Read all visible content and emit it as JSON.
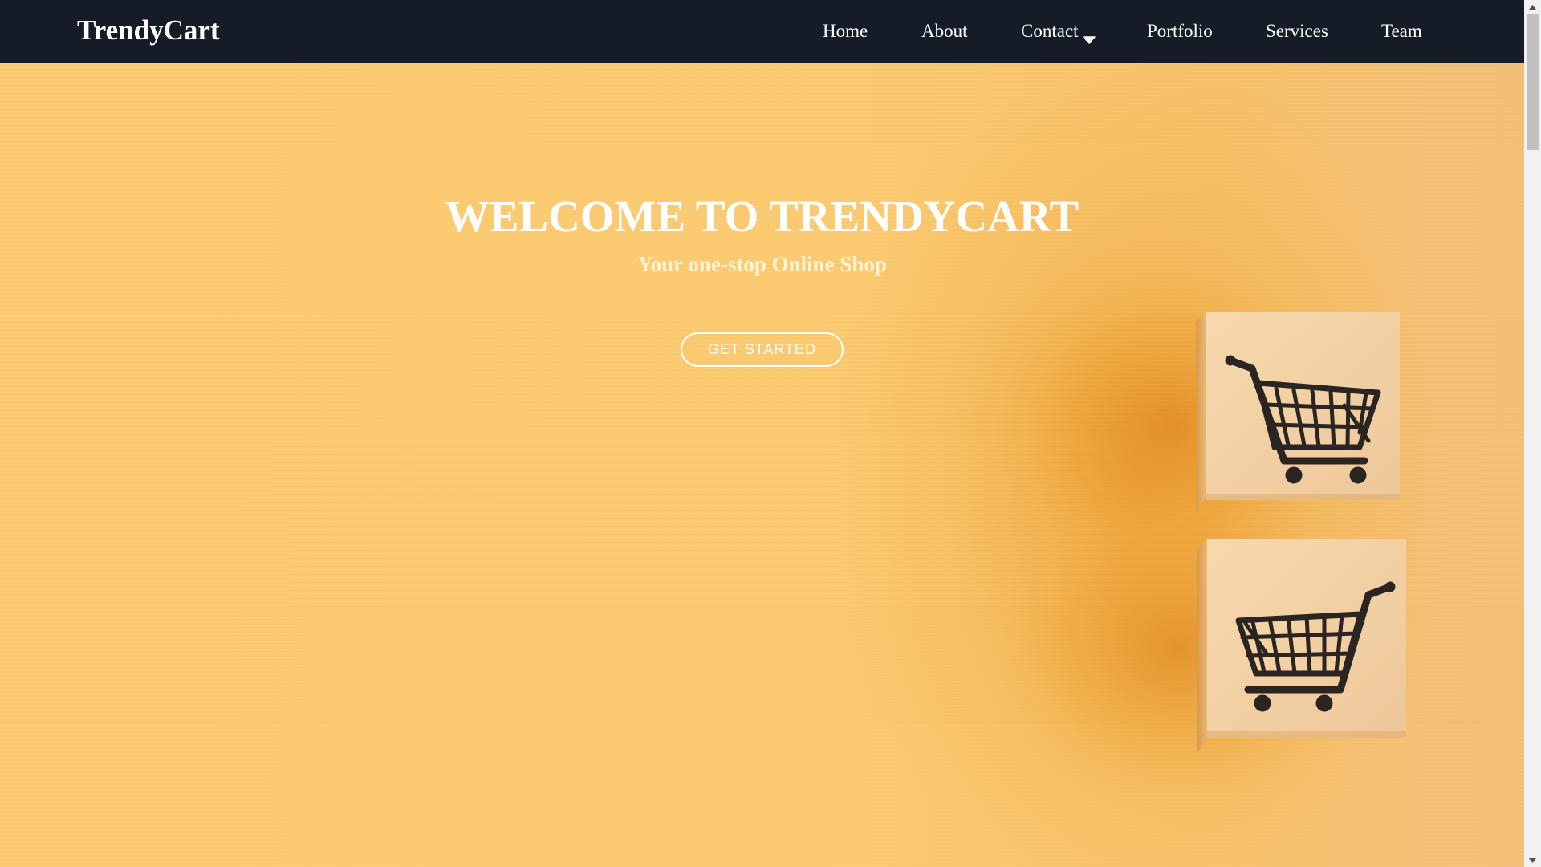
{
  "navbar": {
    "brand": "TrendyCart",
    "items": [
      {
        "label": "Home"
      },
      {
        "label": "About"
      },
      {
        "label": "Contact",
        "icon": "caret-down-icon"
      },
      {
        "label": "Portfolio"
      },
      {
        "label": "Services"
      },
      {
        "label": "Team"
      }
    ]
  },
  "hero": {
    "title": "WELCOME TO TRENDYCART",
    "subtitle": "Your one-stop Online Shop",
    "cta_label": "GET STARTED",
    "image_icon": "shopping-cart-icon"
  },
  "colors": {
    "navbar_bg": "#151c27",
    "hero_bg": "#fcc96e",
    "text": "#ffffff",
    "cube": "#f3cfa0"
  }
}
